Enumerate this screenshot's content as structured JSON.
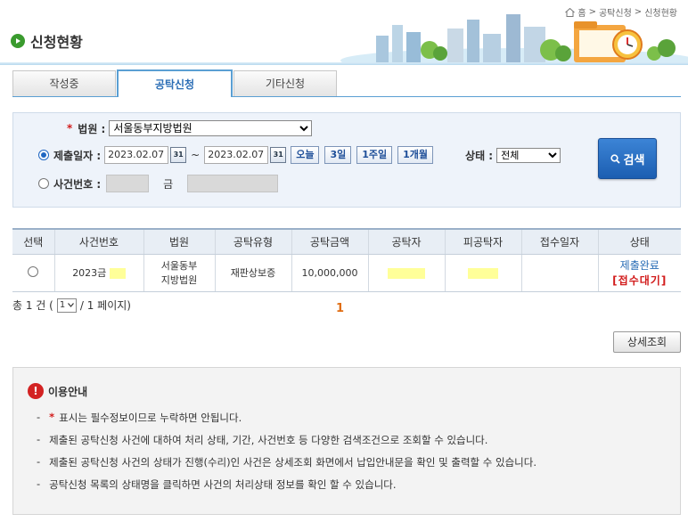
{
  "breadcrumb": [
    "홈",
    "공탁신청",
    "신청현황"
  ],
  "page_title": "신청현황",
  "tabs": [
    {
      "label": "작성중",
      "active": false
    },
    {
      "label": "공탁신청",
      "active": true
    },
    {
      "label": "기타신청",
      "active": false
    }
  ],
  "search": {
    "required_mark": "*",
    "court_label": "법원 :",
    "court_value": "서울동부지방법원",
    "date_label": "제출일자 :",
    "date_from": "2023.02.07",
    "date_to": "2023.02.07",
    "date_sep": "~",
    "calendar_icon_text": "31",
    "quick_buttons": [
      "오늘",
      "3일",
      "1주일",
      "1개월"
    ],
    "status_label": "상태 :",
    "status_value": "전체",
    "case_label": "사건번호 :",
    "case_mid": "금",
    "search_button": "검색"
  },
  "table": {
    "headers": [
      "선택",
      "사건번호",
      "법원",
      "공탁유형",
      "공탁금액",
      "공탁자",
      "피공탁자",
      "접수일자",
      "상태"
    ],
    "rows": [
      {
        "case_no": "2023금",
        "court_line1": "서울동부",
        "court_line2": "지방법원",
        "type": "재판상보증",
        "amount": "10,000,000",
        "receipt_date": "",
        "status_line1": "제출완료",
        "status_line2": "[접수대기]"
      }
    ]
  },
  "pager": {
    "total_prefix": "총 1 건 (",
    "page_value": "1",
    "total_suffix": "/ 1 페이지)",
    "current_page": "1"
  },
  "detail_button": "상세조회",
  "info": {
    "icon": "!",
    "title": "이용안내",
    "items": [
      {
        "star": "*",
        "text": "표시는 필수정보이므로 누락하면 안됩니다."
      },
      {
        "star": "",
        "text": "제출된 공탁신청 사건에 대하여 처리 상태, 기간, 사건번호 등 다양한 검색조건으로 조회할 수 있습니다."
      },
      {
        "star": "",
        "text": "제출된 공탁신청 사건의 상태가 진행(수리)인 사건은 상세조회 화면에서 납입안내문을 확인 및 출력할 수 있습니다."
      },
      {
        "star": "",
        "text": "공탁신청 목록의 상태명을 클릭하면 사건의 처리상태 정보를 확인 할 수 있습니다."
      }
    ],
    "dash": "-"
  },
  "colors": {
    "accent": "#2a6db5",
    "required": "#d21c1c",
    "search_button": "#1c5eb1",
    "page_number": "#e06d12",
    "highlight": "#ffff99"
  }
}
